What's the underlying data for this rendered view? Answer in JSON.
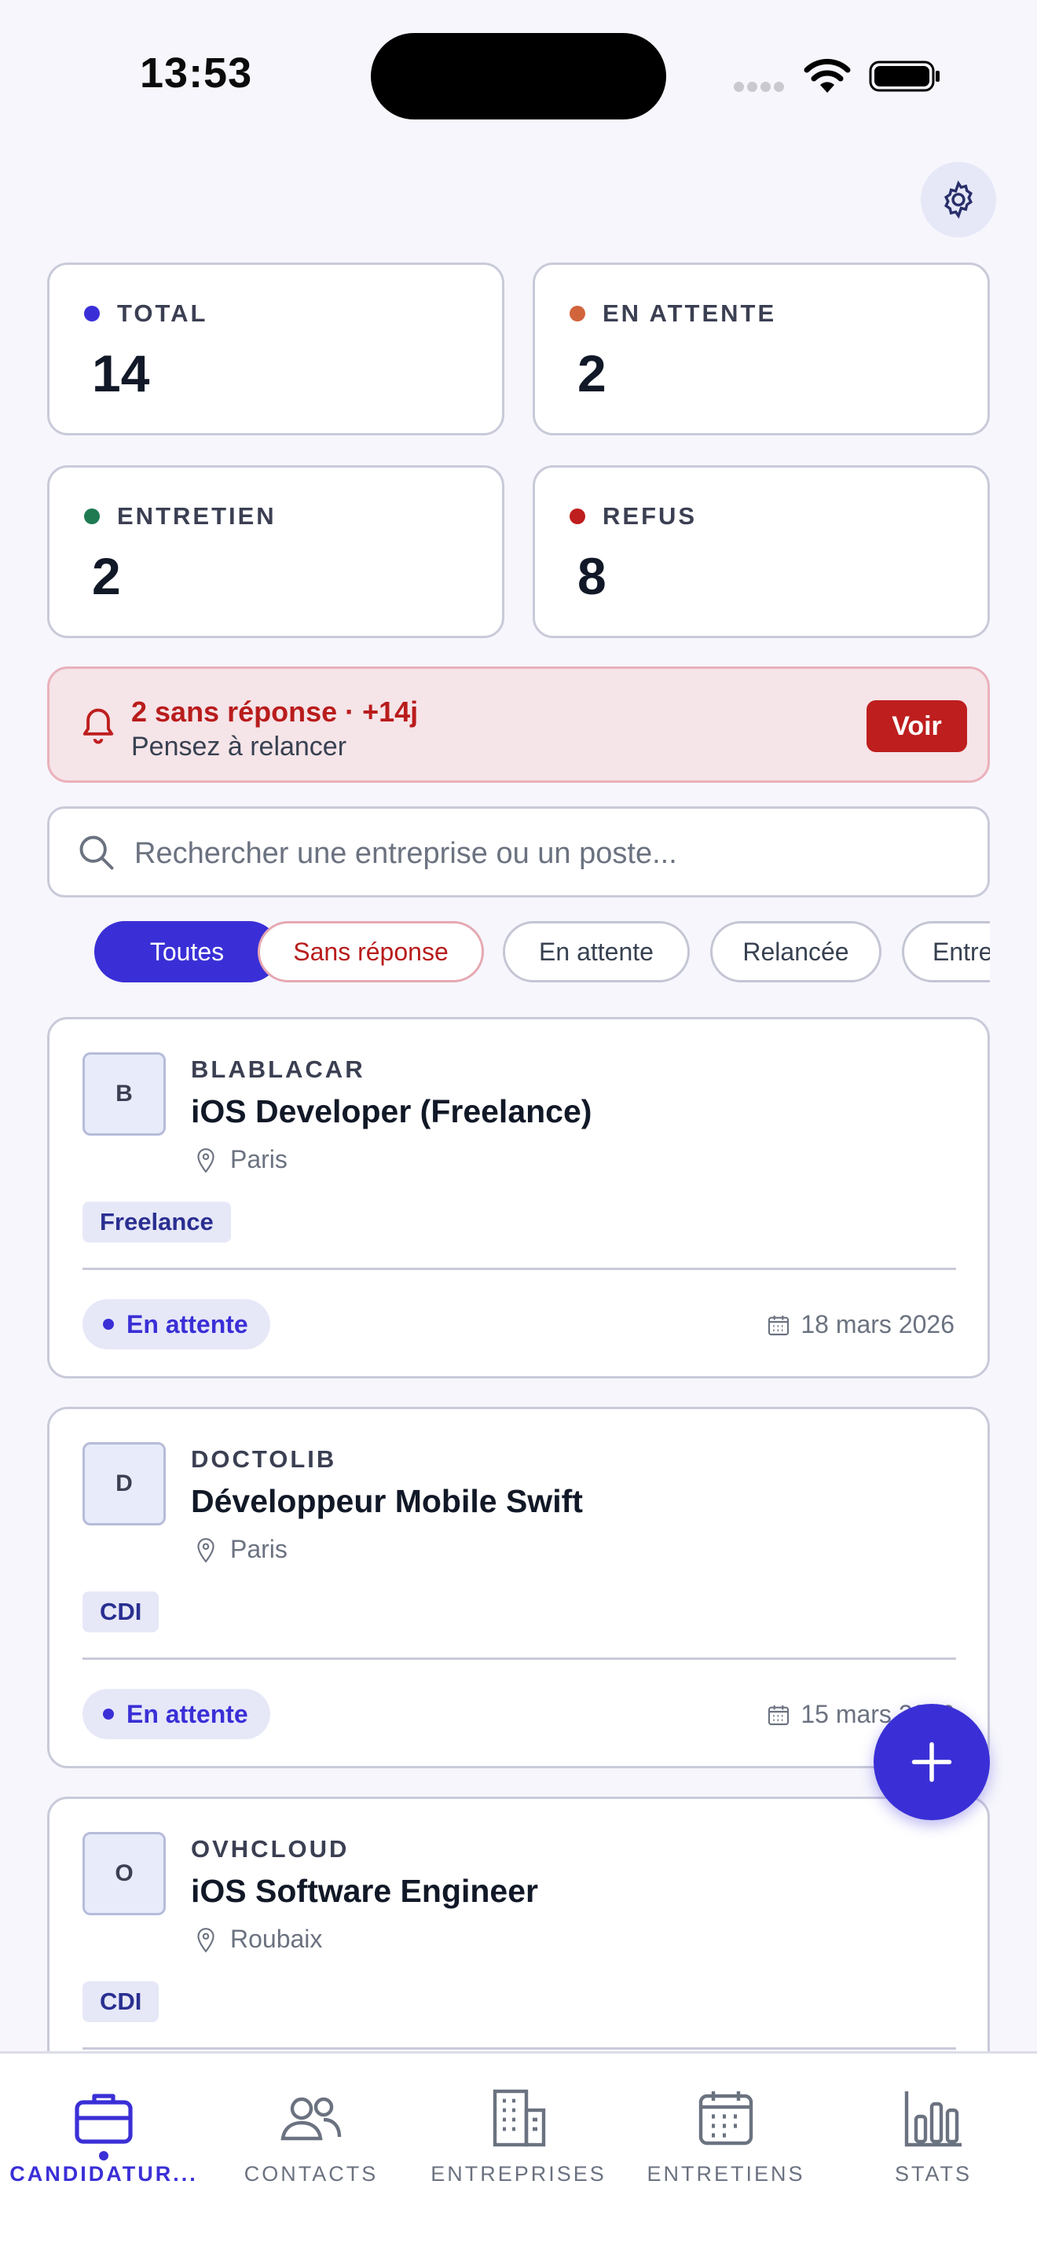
{
  "status_bar": {
    "time": "13:53"
  },
  "stats": [
    {
      "label": "TOTAL",
      "value": "14",
      "color": "#3a2fd6"
    },
    {
      "label": "EN ATTENTE",
      "value": "2",
      "color": "#d2643c"
    },
    {
      "label": "ENTRETIEN",
      "value": "2",
      "color": "#1f7a52"
    },
    {
      "label": "REFUS",
      "value": "8",
      "color": "#be1e1e"
    }
  ],
  "alert": {
    "title": "2 sans réponse · +14j",
    "subtitle": "Pensez à relancer",
    "button": "Voir",
    "icon": "bell-icon"
  },
  "search": {
    "placeholder": "Rechercher une entreprise ou un poste..."
  },
  "filters": [
    {
      "label": "Toutes",
      "active": true
    },
    {
      "label": "Sans réponse"
    },
    {
      "label": "En attente"
    },
    {
      "label": "Relancée"
    },
    {
      "label": "Entretien"
    }
  ],
  "applications": [
    {
      "initial": "B",
      "company": "BLABLACAR",
      "title": "iOS Developer (Freelance)",
      "location": "Paris",
      "contract": "Freelance",
      "status": "En attente",
      "date": "18 mars 2026"
    },
    {
      "initial": "D",
      "company": "DOCTOLIB",
      "title": "Développeur Mobile Swift",
      "location": "Paris",
      "contract": "CDI",
      "status": "En attente",
      "date": "15 mars 2026"
    },
    {
      "initial": "O",
      "company": "OVHCLOUD",
      "title": "iOS Software Engineer",
      "location": "Roubaix",
      "contract": "CDI"
    }
  ],
  "tabs": [
    {
      "label": "CANDIDATUR...",
      "icon": "briefcase-icon",
      "active": true
    },
    {
      "label": "CONTACTS",
      "icon": "people-icon"
    },
    {
      "label": "ENTREPRISES",
      "icon": "building-icon"
    },
    {
      "label": "ENTRETIENS",
      "icon": "calendar-icon"
    },
    {
      "label": "STATS",
      "icon": "bar-chart-icon"
    }
  ],
  "colors": {
    "accent": "#3a2fd6",
    "danger": "#be1e1e",
    "background": "#f6f6fc"
  }
}
